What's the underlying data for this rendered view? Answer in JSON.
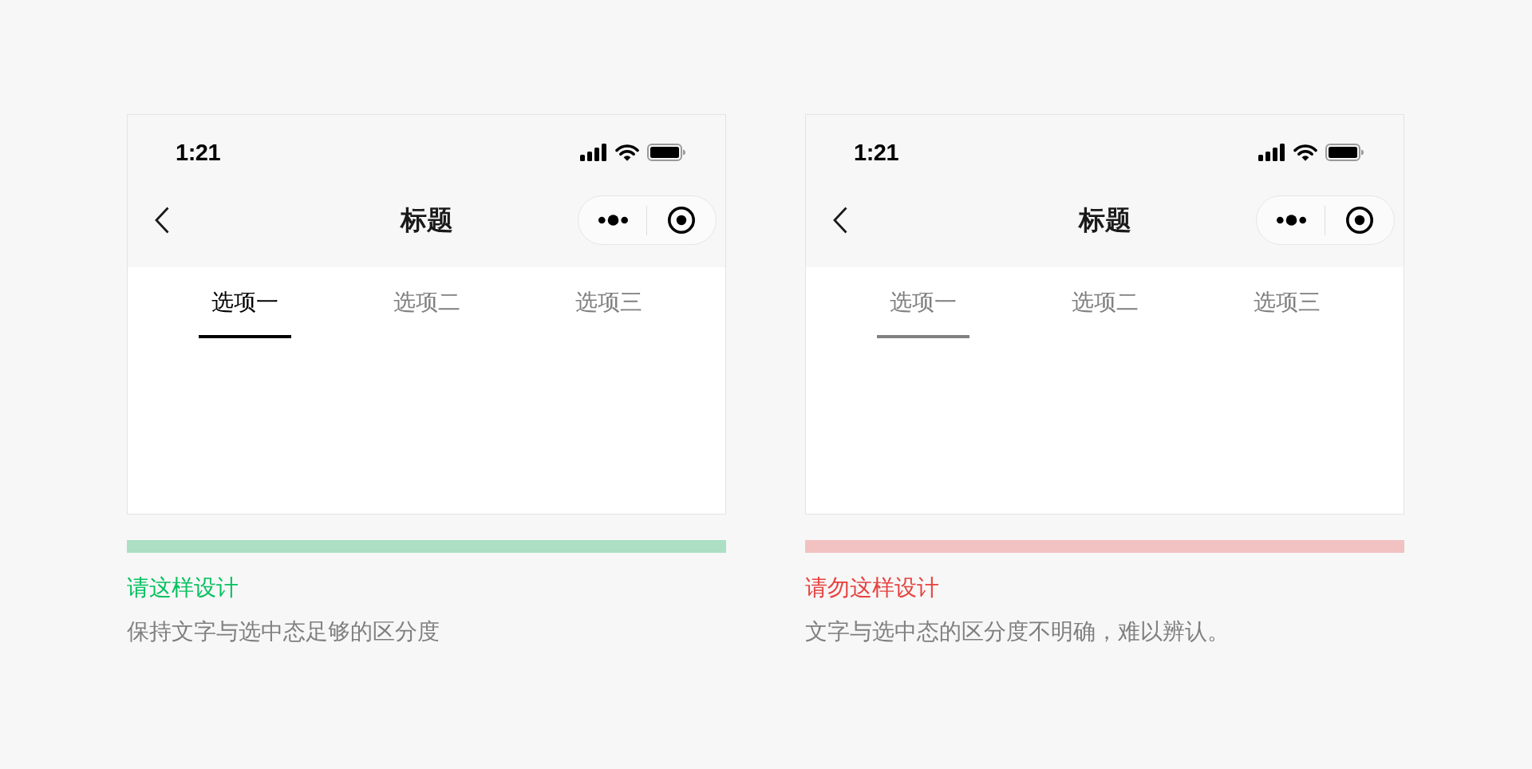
{
  "examples": [
    {
      "kind": "do",
      "status_bar": {
        "time": "1:21"
      },
      "nav_bar": {
        "title": "标题"
      },
      "tabs": [
        {
          "label": "选项一",
          "selected": true
        },
        {
          "label": "选项二",
          "selected": false
        },
        {
          "label": "选项三",
          "selected": false
        }
      ],
      "verdict": {
        "title": "请这样设计",
        "description": "保持文字与选中态足够的区分度"
      }
    },
    {
      "kind": "dont",
      "status_bar": {
        "time": "1:21"
      },
      "nav_bar": {
        "title": "标题"
      },
      "tabs": [
        {
          "label": "选项一",
          "selected": true
        },
        {
          "label": "选项二",
          "selected": false
        },
        {
          "label": "选项三",
          "selected": false
        }
      ],
      "verdict": {
        "title": "请勿这样设计",
        "description": "文字与选中态的区分度不明确，难以辨认。"
      }
    }
  ]
}
